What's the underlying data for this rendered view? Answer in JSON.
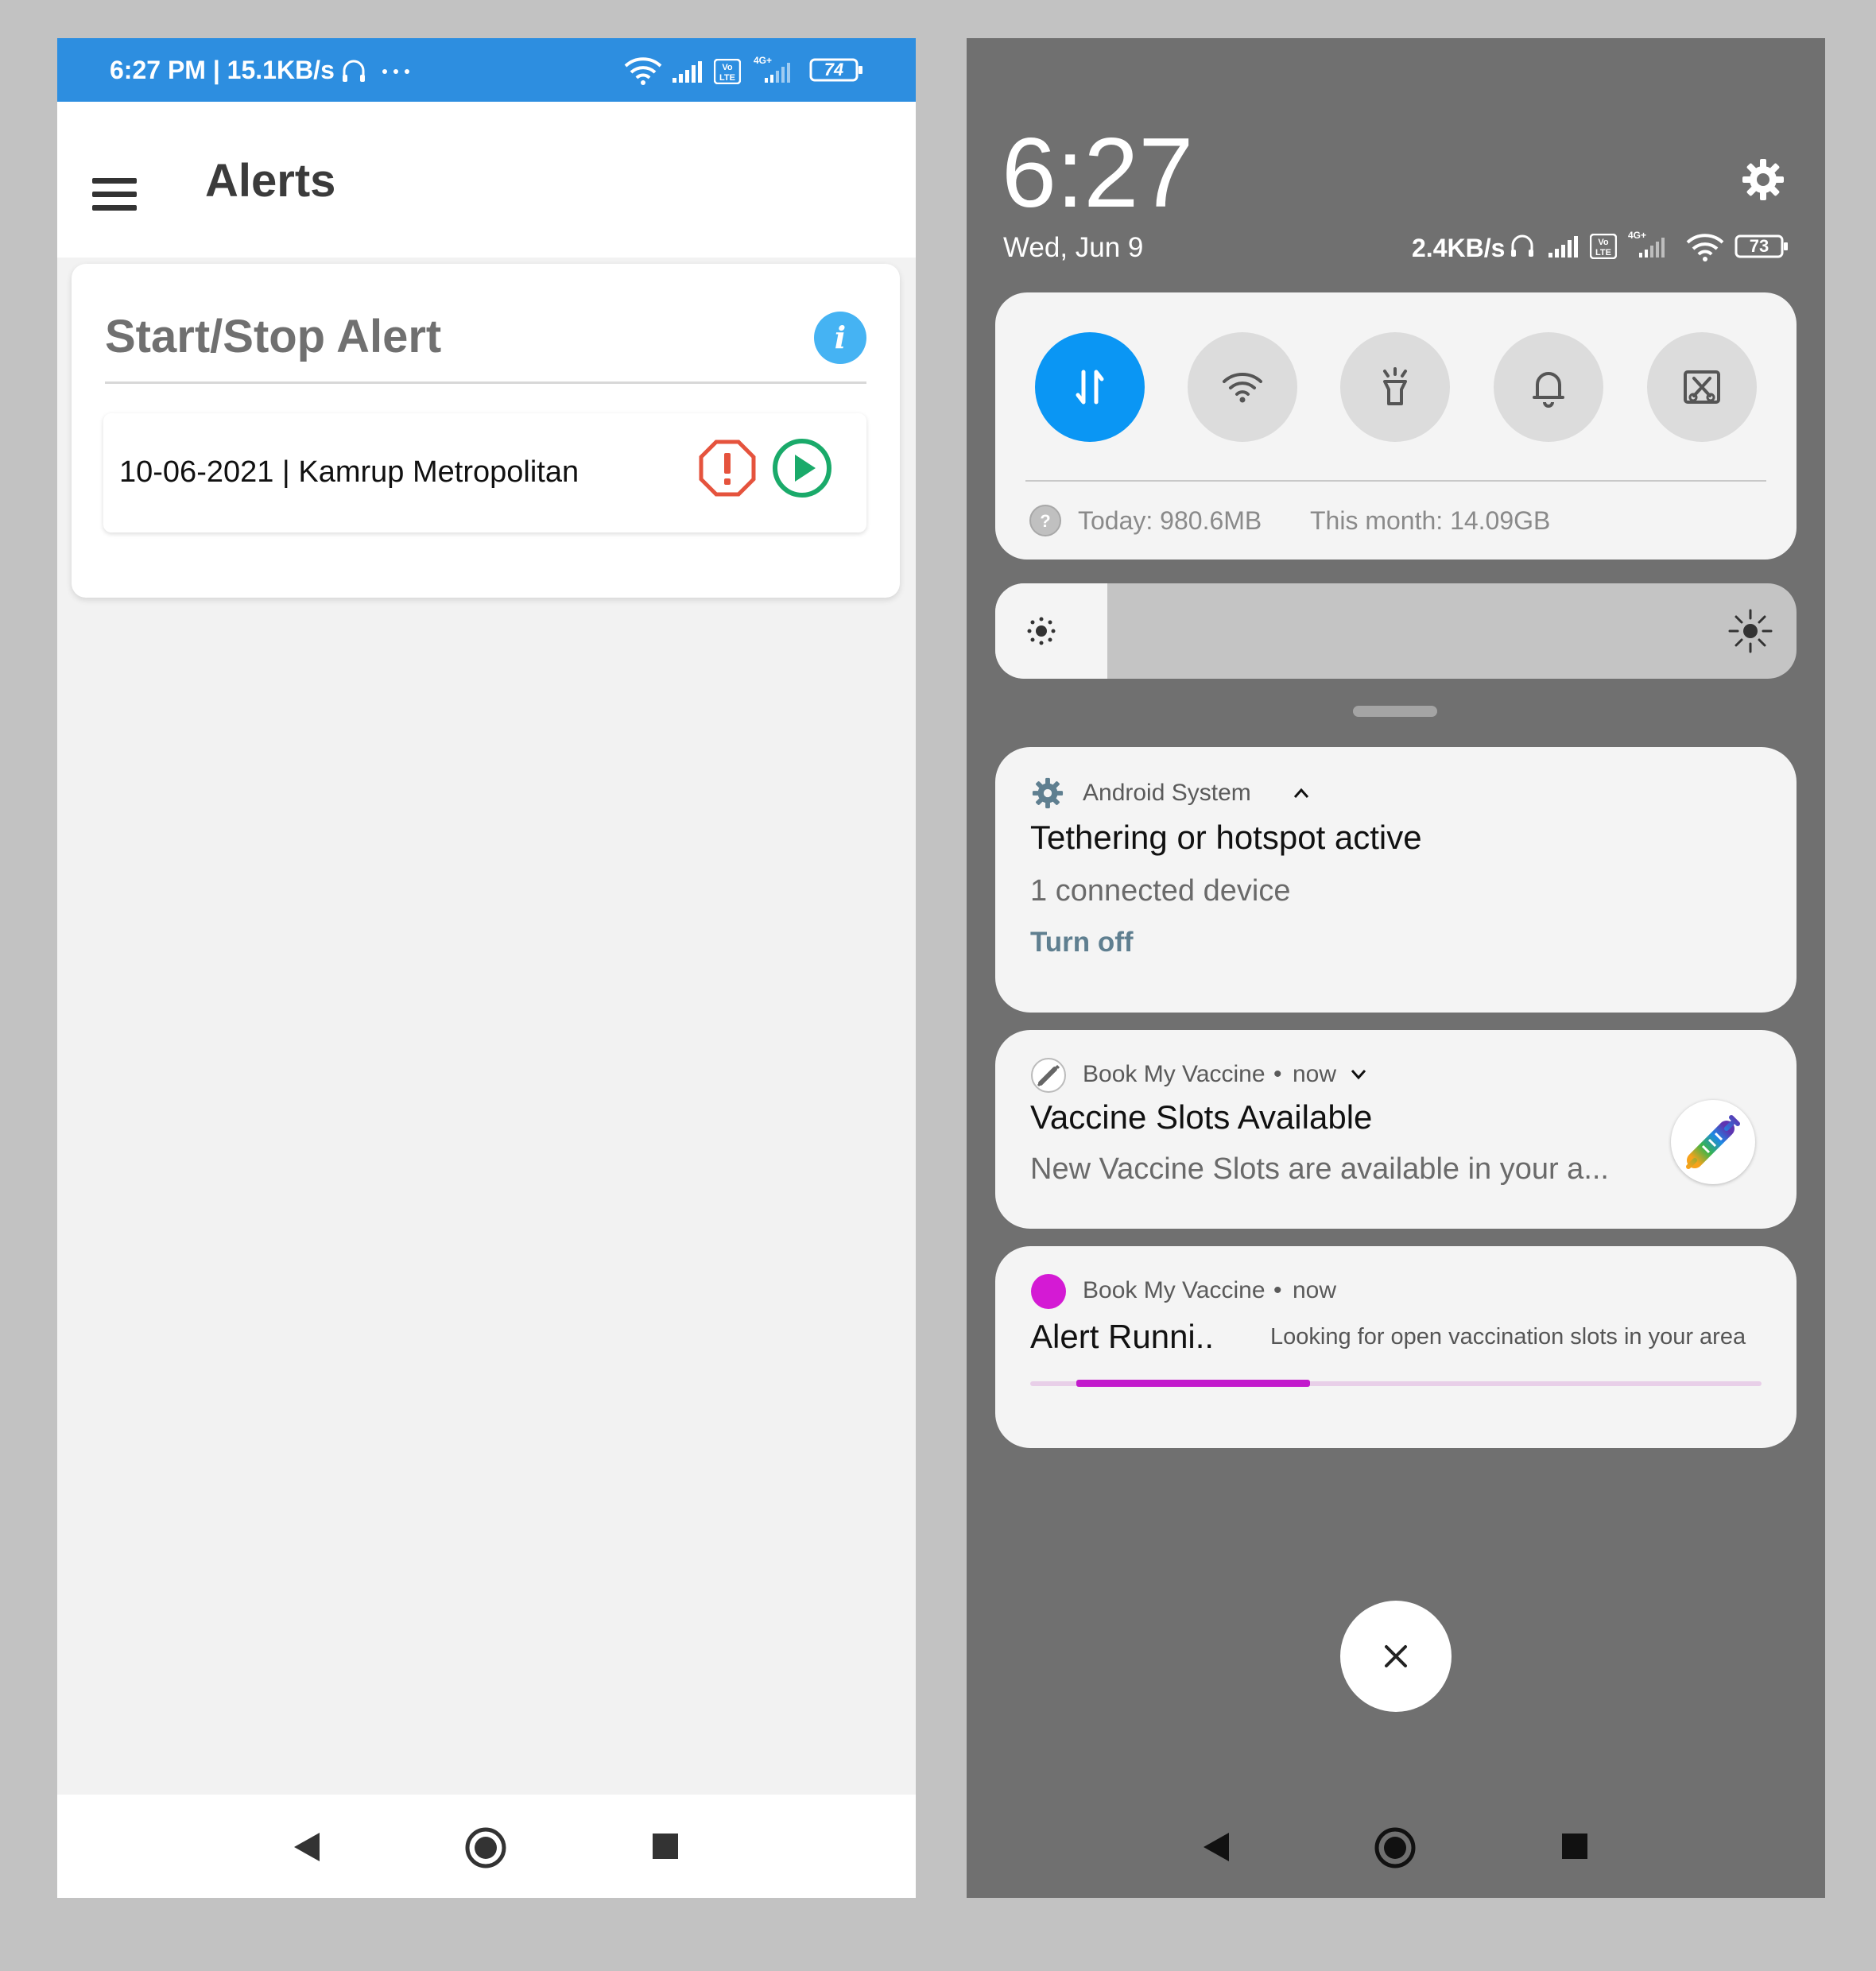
{
  "left_screen": {
    "status_bar": {
      "time_speed": "6:27 PM | 15.1KB/s",
      "battery": "74"
    },
    "app_bar": {
      "title": "Alerts"
    },
    "card": {
      "title": "Start/Stop Alert",
      "info_label": "i",
      "alert": {
        "text": "10-06-2021 | Kamrup Metropolitan"
      }
    }
  },
  "right_screen": {
    "clock": "6:27",
    "date": "Wed, Jun 9",
    "speed": "2.4KB/s",
    "battery": "73",
    "data_usage": {
      "today": "Today: 980.6MB",
      "month": "This month: 14.09GB"
    },
    "brightness_level": 0.14,
    "notifications": [
      {
        "app": "Android System",
        "title": "Tethering or hotspot active",
        "text": "1 connected device",
        "action": "Turn off"
      },
      {
        "app": "Book My Vaccine",
        "time": "now",
        "title": "Vaccine Slots Available",
        "text": "New Vaccine Slots are available in your a..."
      },
      {
        "app": "Book My Vaccine",
        "time": "now",
        "title": "Alert Runni..",
        "text": "Looking for open vaccination slots in your area",
        "progress": 0.32
      }
    ],
    "dot_separator": "•"
  },
  "colors": {
    "status_blue": "#2d8ee0",
    "info_blue": "#45b3f3",
    "stop_red": "#e5533d",
    "play_green": "#1aaa6a",
    "qs_active": "#0a96f4",
    "progress_magenta": "#c21acc"
  },
  "icons": [
    "menu-icon",
    "info-icon",
    "stop-alert-icon",
    "play-icon",
    "back-icon",
    "home-icon",
    "recents-icon",
    "gear-icon",
    "wifi-icon",
    "signal-icon",
    "headphones-icon",
    "mobile-data-icon",
    "flashlight-icon",
    "bell-icon",
    "screenshot-icon",
    "help-icon",
    "brightness-low-icon",
    "brightness-high-icon",
    "syringe-icon",
    "close-icon"
  ]
}
